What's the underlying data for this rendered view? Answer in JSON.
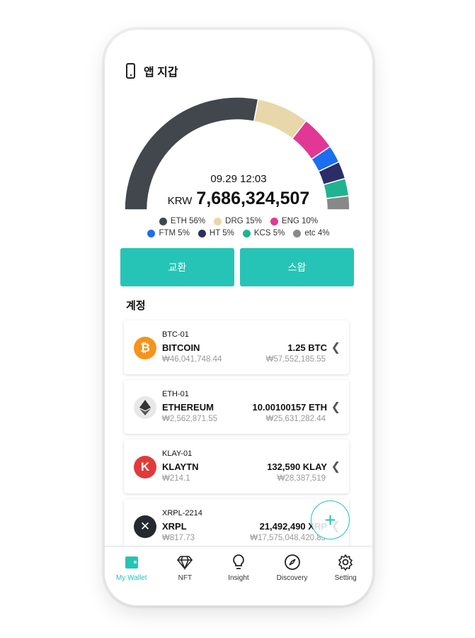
{
  "header": {
    "title": "앱 지갑",
    "icon": "phone-icon"
  },
  "chart_data": {
    "type": "pie",
    "variant": "half-donut",
    "categories": [
      "ETH",
      "DRG",
      "ENG",
      "FTM",
      "HT",
      "KCS",
      "etc"
    ],
    "values": [
      56,
      15,
      10,
      5,
      5,
      5,
      4
    ],
    "colors": [
      "#41474d",
      "#e8d7a9",
      "#e23795",
      "#1b6ef0",
      "#2a2d66",
      "#20b390",
      "#888888"
    ],
    "legend": [
      "ETH 56%",
      "DRG 15%",
      "ENG 10%",
      "FTM 5%",
      "HT 5%",
      "KCS 5%",
      "etc 4%"
    ]
  },
  "summary": {
    "time": "09.29 12:03",
    "currency": "KRW",
    "total": "7,686,324,507"
  },
  "buttons": {
    "exchange": "교환",
    "swap": "스왑"
  },
  "section": "계정",
  "accounts": [
    {
      "id": "BTC-01",
      "name": "BITCOIN",
      "price": "₩46,041,748.44",
      "balance": "1.25 BTC",
      "value": "₩57,552,185.55",
      "icon": "bitcoin-icon",
      "color": "#f7931a"
    },
    {
      "id": "ETH-01",
      "name": "ETHEREUM",
      "price": "₩2,562,871.55",
      "balance": "10.00100157 ETH",
      "value": "₩25,631,282.44",
      "icon": "ethereum-icon",
      "color": "#e8e8e8"
    },
    {
      "id": "KLAY-01",
      "name": "KLAYTN",
      "price": "₩214.1",
      "balance": "132,590 KLAY",
      "value": "₩28,387,519",
      "icon": "klaytn-icon",
      "color": "#e23a3a"
    },
    {
      "id": "XRPL-2214",
      "name": "XRPL",
      "price": "₩817.73",
      "balance": "21,492,490 XRP",
      "value": "₩17,575,048,420.85",
      "icon": "xrp-icon",
      "color": "#23292f"
    }
  ],
  "accent": "#26c4b6",
  "nav": [
    {
      "label": "My Wallet",
      "icon": "wallet-icon",
      "active": true
    },
    {
      "label": "NFT",
      "icon": "diamond-icon"
    },
    {
      "label": "Insight",
      "icon": "lightbulb-icon"
    },
    {
      "label": "Discovery",
      "icon": "compass-icon"
    },
    {
      "label": "Setting",
      "icon": "gear-icon"
    }
  ]
}
